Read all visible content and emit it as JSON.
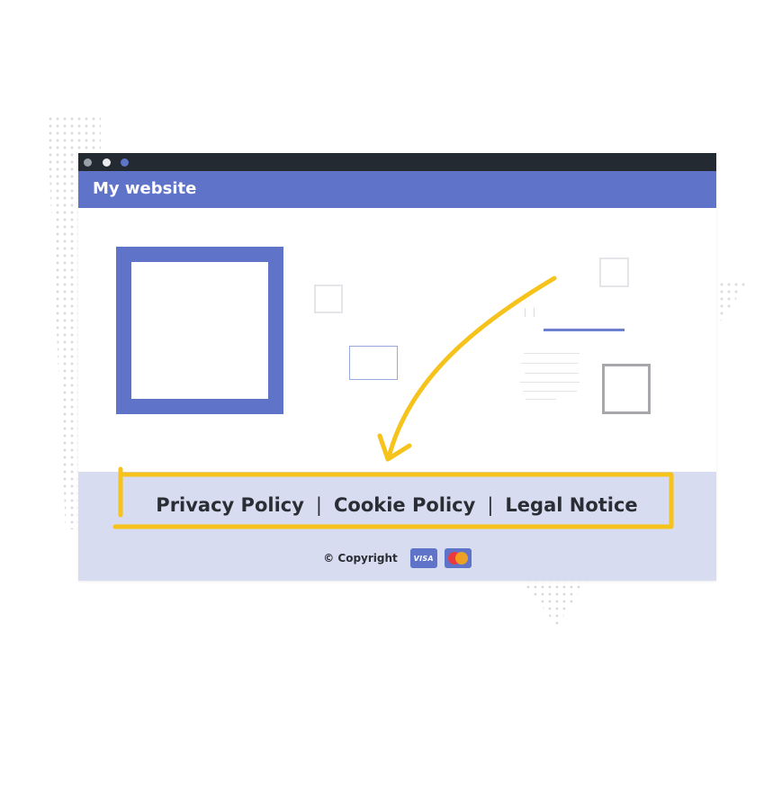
{
  "window": {
    "controls": [
      "close-dot",
      "minimize-dot",
      "maximize-dot"
    ]
  },
  "header": {
    "site_title": "My website"
  },
  "footer": {
    "links": [
      {
        "label": "Privacy Policy"
      },
      {
        "label": "Cookie Policy"
      },
      {
        "label": "Legal Notice"
      }
    ],
    "separator": "|",
    "copyright": "© Copyright",
    "payment_icons": [
      {
        "name": "visa-icon",
        "label": "VISA"
      },
      {
        "name": "mastercard-icon",
        "label": ""
      }
    ]
  },
  "colors": {
    "brand": "#5f74c9",
    "titlebar": "#232a31",
    "footer_bg": "#d8dcf0",
    "highlight": "#f5c31c",
    "text": "#2b2d34"
  },
  "icons": {
    "annotation_arrow": "curved-arrow-icon",
    "highlight_frame": "highlight-box-icon"
  }
}
